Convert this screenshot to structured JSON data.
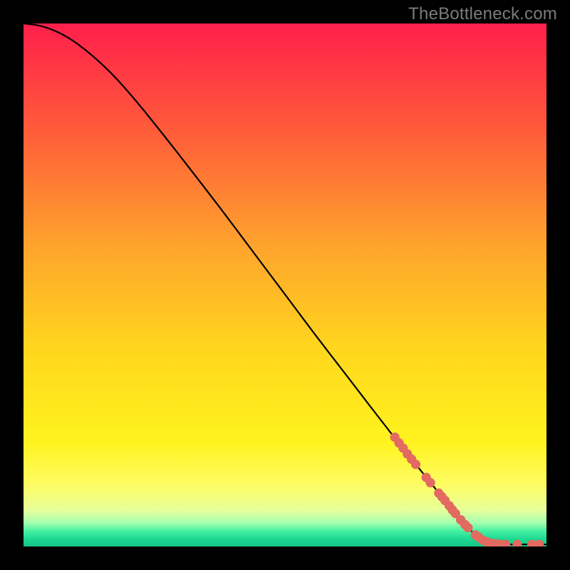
{
  "watermark": "TheBottleneck.com",
  "chart_data": {
    "type": "line",
    "title": "",
    "xlabel": "",
    "ylabel": "",
    "xlim": [
      0,
      100
    ],
    "ylim": [
      0,
      100
    ],
    "grid": false,
    "legend": false,
    "background_gradient": {
      "stops": [
        {
          "pct": 0,
          "color": "#ff1f4b"
        },
        {
          "pct": 20,
          "color": "#ff5a3a"
        },
        {
          "pct": 42,
          "color": "#ffa22d"
        },
        {
          "pct": 62,
          "color": "#ffd61e"
        },
        {
          "pct": 80,
          "color": "#fff31e"
        },
        {
          "pct": 88,
          "color": "#fffc62"
        },
        {
          "pct": 93,
          "color": "#e8ff9a"
        },
        {
          "pct": 95.5,
          "color": "#a4ffb0"
        },
        {
          "pct": 97,
          "color": "#46f1a2"
        },
        {
          "pct": 98.5,
          "color": "#1fd992"
        },
        {
          "pct": 100,
          "color": "#14c585"
        }
      ]
    },
    "series": [
      {
        "name": "curve",
        "color": "#000000",
        "points": [
          {
            "x": 0,
            "y": 100.0
          },
          {
            "x": 3,
            "y": 99.6
          },
          {
            "x": 6,
            "y": 98.6
          },
          {
            "x": 9,
            "y": 97.0
          },
          {
            "x": 12,
            "y": 94.8
          },
          {
            "x": 15,
            "y": 92.2
          },
          {
            "x": 18,
            "y": 89.2
          },
          {
            "x": 22,
            "y": 84.6
          },
          {
            "x": 27,
            "y": 78.4
          },
          {
            "x": 32,
            "y": 72.0
          },
          {
            "x": 38,
            "y": 64.2
          },
          {
            "x": 44,
            "y": 56.2
          },
          {
            "x": 50,
            "y": 48.2
          },
          {
            "x": 56,
            "y": 40.2
          },
          {
            "x": 62,
            "y": 32.4
          },
          {
            "x": 68,
            "y": 24.6
          },
          {
            "x": 73,
            "y": 18.2
          },
          {
            "x": 78,
            "y": 12.0
          },
          {
            "x": 82,
            "y": 7.0
          },
          {
            "x": 85,
            "y": 3.6
          },
          {
            "x": 87,
            "y": 1.8
          },
          {
            "x": 89,
            "y": 0.8
          },
          {
            "x": 91,
            "y": 0.4
          },
          {
            "x": 94,
            "y": 0.4
          },
          {
            "x": 97,
            "y": 0.4
          },
          {
            "x": 100,
            "y": 0.4
          }
        ]
      }
    ],
    "markers": {
      "name": "highlighted-segment",
      "color": "#e26a60",
      "radius_pct": 0.9,
      "points": [
        {
          "x": 71.0,
          "y": 20.9
        },
        {
          "x": 71.8,
          "y": 19.8
        },
        {
          "x": 72.6,
          "y": 18.8
        },
        {
          "x": 73.4,
          "y": 17.7
        },
        {
          "x": 74.2,
          "y": 16.7
        },
        {
          "x": 75.0,
          "y": 15.7
        },
        {
          "x": 77.0,
          "y": 13.2
        },
        {
          "x": 77.8,
          "y": 12.2
        },
        {
          "x": 79.4,
          "y": 10.2
        },
        {
          "x": 80.0,
          "y": 9.5
        },
        {
          "x": 80.6,
          "y": 8.8
        },
        {
          "x": 81.4,
          "y": 7.8
        },
        {
          "x": 82.0,
          "y": 7.0
        },
        {
          "x": 82.6,
          "y": 6.3
        },
        {
          "x": 83.6,
          "y": 5.1
        },
        {
          "x": 84.4,
          "y": 4.2
        },
        {
          "x": 85.0,
          "y": 3.6
        },
        {
          "x": 86.4,
          "y": 2.2
        },
        {
          "x": 87.0,
          "y": 1.8
        },
        {
          "x": 87.8,
          "y": 1.2
        },
        {
          "x": 88.6,
          "y": 0.9
        },
        {
          "x": 89.6,
          "y": 0.6
        },
        {
          "x": 90.4,
          "y": 0.5
        },
        {
          "x": 91.2,
          "y": 0.4
        },
        {
          "x": 92.2,
          "y": 0.4
        },
        {
          "x": 94.4,
          "y": 0.4
        },
        {
          "x": 97.2,
          "y": 0.4
        },
        {
          "x": 98.6,
          "y": 0.4
        }
      ]
    }
  }
}
